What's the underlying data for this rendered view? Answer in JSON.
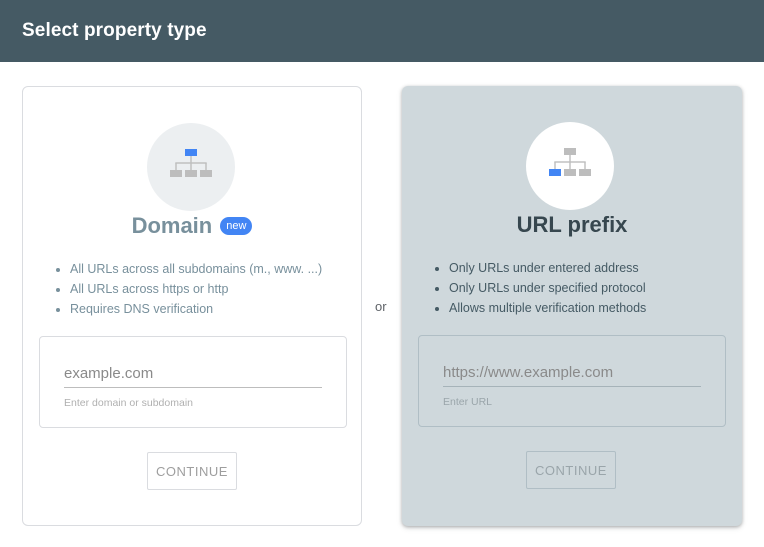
{
  "header": {
    "title": "Select property type"
  },
  "separator": "or",
  "domain_card": {
    "title": "Domain",
    "badge": "new",
    "icon": "sitemap-top-highlight-icon",
    "features": [
      "All URLs across all subdomains (m., www. ...)",
      "All URLs across https or http",
      "Requires DNS verification"
    ],
    "input_placeholder": "example.com",
    "input_helper": "Enter domain or subdomain",
    "continue_label": "CONTINUE"
  },
  "url_card": {
    "title": "URL prefix",
    "icon": "sitemap-leaf-highlight-icon",
    "features": [
      "Only URLs under entered address",
      "Only URLs under specified protocol",
      "Allows multiple verification methods"
    ],
    "input_placeholder": "https://www.example.com",
    "input_helper": "Enter URL",
    "continue_label": "CONTINUE"
  },
  "colors": {
    "header_bg": "#455a64",
    "accent_blue": "#4285f4",
    "selected_card_bg": "#cfd8dc"
  }
}
